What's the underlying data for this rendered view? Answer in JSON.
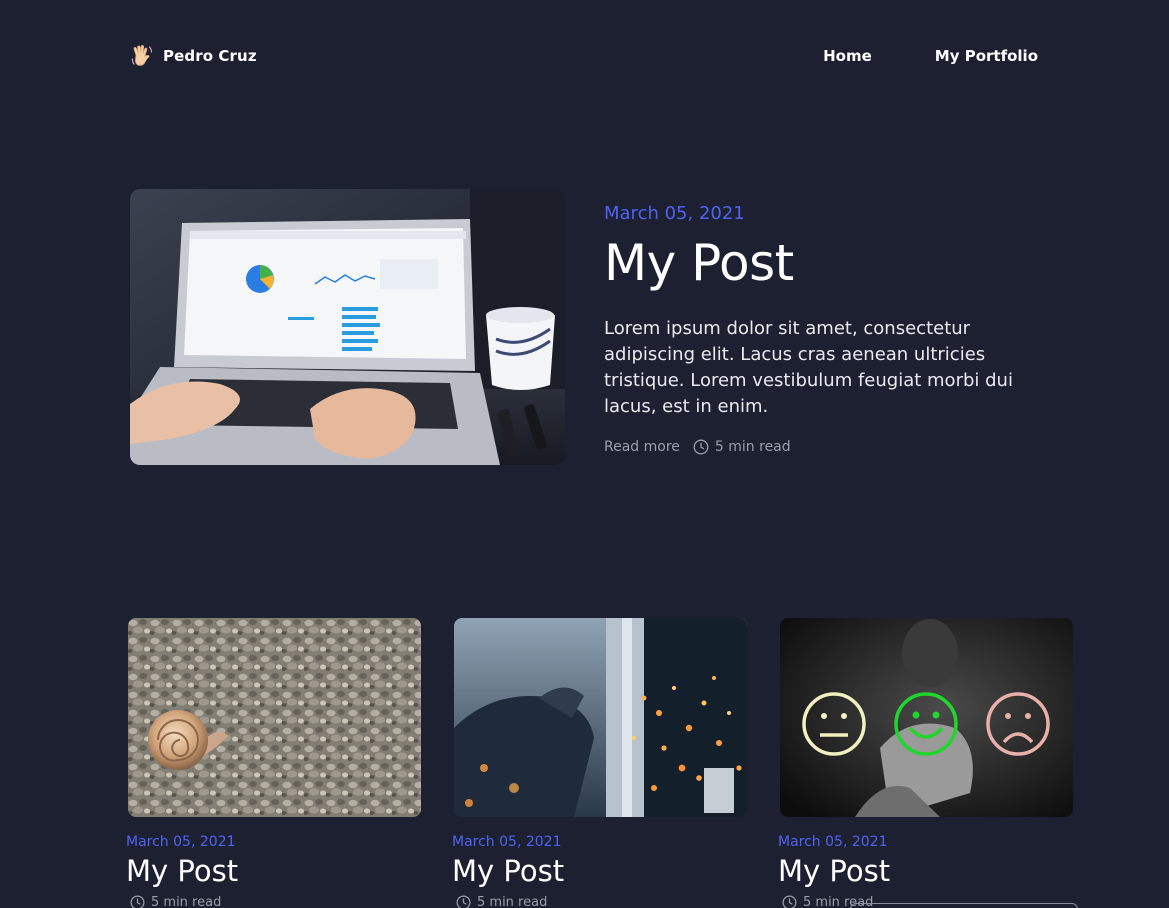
{
  "header": {
    "brand_name": "Pedro Cruz",
    "nav": [
      {
        "label": "Home"
      },
      {
        "label": "My Portfolio"
      }
    ]
  },
  "featured": {
    "date": "March 05, 2021",
    "title": "My Post",
    "excerpt": "Lorem ipsum dolor sit amet, consectetur adipiscing elit. Lacus cras aenean ultricies tristique. Lorem vestibulum feugiat morbi dui lacus, est in enim.",
    "read_more": "Read more",
    "read_time": "5 min read"
  },
  "posts": [
    {
      "date": "March 05, 2021",
      "title": "My Post",
      "read_time": "5 min read"
    },
    {
      "date": "March 05, 2021",
      "title": "My Post",
      "read_time": "5 min read"
    },
    {
      "date": "March 05, 2021",
      "title": "My Post",
      "read_time": "5 min read"
    }
  ],
  "colors": {
    "background": "#1d2030",
    "accent_date": "#4f63f2",
    "muted_text": "#9b9eab"
  },
  "icons": {
    "brand": "waving-hand-icon",
    "read_time": "clock-icon"
  }
}
